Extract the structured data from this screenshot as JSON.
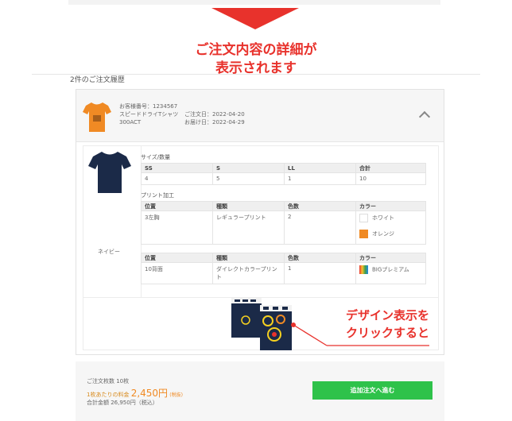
{
  "annotations": {
    "top_line1": "ご注文内容の詳細が",
    "top_line2": "表示されます",
    "click_line1": "デザイン表示を",
    "click_line2": "クリックすると"
  },
  "history_title": "2件のご注文履歴",
  "order": {
    "number": "お客様番号：1234567",
    "product_name": "スピードドライTシャツ",
    "product_code": "300ACT",
    "order_date": "ご注文日：2022-04-20",
    "delivery_date": "お届け日：2022-04-29",
    "shirt_color_thumb": "#f08a24"
  },
  "detail": {
    "item_color_name": "ネイビー",
    "shirt_color": "#1b2a48",
    "size_label": "サイズ/数量",
    "size_table": {
      "headers": [
        "SS",
        "S",
        "LL",
        "合計"
      ],
      "values": [
        "4",
        "5",
        "1",
        "10"
      ]
    },
    "print_label": "プリント加工",
    "print_headers": [
      "位置",
      "種類",
      "色数",
      "カラー"
    ],
    "print_rows": [
      {
        "position": "3左胸",
        "type": "レギュラープリント",
        "count": "2",
        "colors": [
          "ホワイト",
          "オレンジ"
        ]
      },
      {
        "position": "10背面",
        "type": "ダイレクトカラープリント",
        "count": "1",
        "colors": [
          "BIGプレミアム"
        ]
      }
    ]
  },
  "summary": {
    "total_qty": "ご注文枚数 10枚",
    "unit_price_label": "1枚あたりの料金",
    "unit_price": "2,450円",
    "unit_price_tax": "(税抜)",
    "total_amount": "合計金額 26,950円（税込）",
    "add_button": "追加注文へ進む"
  },
  "colors": {
    "accent_red": "#e8322c",
    "button_green": "#2ec24a",
    "orange": "#f08a24",
    "navy": "#1b2a48"
  }
}
